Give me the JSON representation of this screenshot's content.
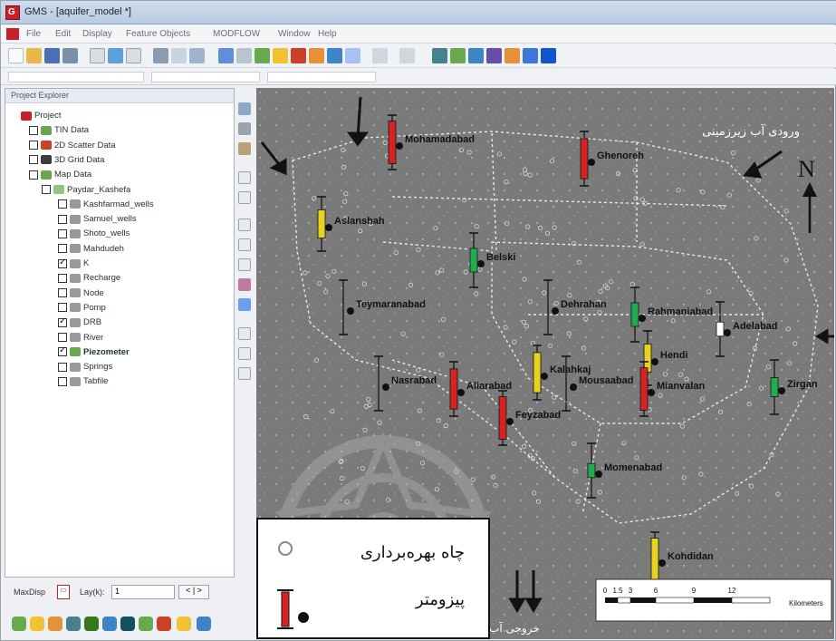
{
  "window": {
    "title": "GMS - [aquifer_model *]",
    "menu": [
      "File",
      "Edit",
      "Display",
      "Feature Objects",
      "MODFLOW",
      "Window",
      "Help"
    ]
  },
  "explorer": {
    "title": "Project Explorer",
    "tree": [
      {
        "label": "Project",
        "level": 0,
        "check": "none",
        "icon": "project-icon",
        "color": "#c8202a"
      },
      {
        "label": "TIN Data",
        "level": 1,
        "check": "empty",
        "icon": "tin-data-icon",
        "color": "#6aa84f"
      },
      {
        "label": "2D Scatter Data",
        "level": 1,
        "check": "empty",
        "icon": "scatter-data-icon",
        "color": "#cc4125"
      },
      {
        "label": "3D Grid Data",
        "level": 1,
        "check": "empty",
        "icon": "grid-data-icon",
        "color": "#3c3c3c"
      },
      {
        "label": "Map Data",
        "level": 1,
        "check": "empty",
        "icon": "map-data-icon",
        "color": "#6aa84f"
      },
      {
        "label": "Paydar_Kashefa",
        "level": 2,
        "check": "empty",
        "icon": "coverage-icon",
        "color": "#93c47d"
      },
      {
        "label": "Kashfarmad_wells",
        "level": 3,
        "check": "empty",
        "icon": "layer-icon",
        "color": "#999999"
      },
      {
        "label": "Samuel_wells",
        "level": 3,
        "check": "empty",
        "icon": "layer-icon",
        "color": "#999999"
      },
      {
        "label": "Shoto_wells",
        "level": 3,
        "check": "empty",
        "icon": "layer-icon",
        "color": "#999999"
      },
      {
        "label": "Mahdudeh",
        "level": 3,
        "check": "empty",
        "icon": "layer-icon",
        "color": "#999999"
      },
      {
        "label": "K",
        "level": 3,
        "check": "checked",
        "icon": "layer-icon",
        "color": "#999999"
      },
      {
        "label": "Recharge",
        "level": 3,
        "check": "empty",
        "icon": "layer-icon",
        "color": "#999999"
      },
      {
        "label": "Node",
        "level": 3,
        "check": "empty",
        "icon": "layer-icon",
        "color": "#999999"
      },
      {
        "label": "Pomp",
        "level": 3,
        "check": "empty",
        "icon": "layer-icon",
        "color": "#999999"
      },
      {
        "label": "DRB",
        "level": 3,
        "check": "checked",
        "icon": "layer-icon",
        "color": "#999999"
      },
      {
        "label": "River",
        "level": 3,
        "check": "empty",
        "icon": "layer-icon",
        "color": "#999999"
      },
      {
        "label": "Piezometer",
        "level": 3,
        "check": "checked",
        "icon": "layer-icon",
        "color": "#6aa84f",
        "bold": true
      },
      {
        "label": "Springs",
        "level": 3,
        "check": "empty",
        "icon": "layer-icon",
        "color": "#999999"
      },
      {
        "label": "Tabfile",
        "level": 3,
        "check": "empty",
        "icon": "layer-icon",
        "color": "#999999"
      }
    ]
  },
  "status": {
    "max_disp_label": "MaxDisp",
    "layer_label": "Lay(k):",
    "layer_value": "1",
    "arrows": "< | >"
  },
  "map": {
    "flow_in_label": "ورودی آب زیرزمینی",
    "flow_out_label": "خروجی آب زیرزمینی",
    "north_letter": "N",
    "legend": {
      "well_label": "چاه بهره‌برداری",
      "piezo_label": "پیزومتر"
    },
    "scalebar": {
      "ticks": [
        "0",
        "1.5",
        "3",
        "6",
        "9",
        "12"
      ],
      "unit": "Kilometers"
    },
    "sites": [
      {
        "name": "Mohamadabad",
        "color": "#d42323",
        "level": 0.9
      },
      {
        "name": "Ghenoreh",
        "color": "#d42323",
        "level": 0.85
      },
      {
        "name": "Aslanshah",
        "color": "#e6d21f",
        "level": 0.6
      },
      {
        "name": "Belski",
        "color": "#1fae4e",
        "level": 0.5
      },
      {
        "name": "Teymaranabad",
        "color": "#888888",
        "level": 0.0
      },
      {
        "name": "Dehrahan",
        "color": "#888888",
        "level": 0.0
      },
      {
        "name": "Rahmaniabad",
        "color": "#1fae4e",
        "level": 0.5
      },
      {
        "name": "Adelabad",
        "color": "#ffffff",
        "level": 0.3
      },
      {
        "name": "Hendi",
        "color": "#e6d21f",
        "level": 0.6
      },
      {
        "name": "Kalahkaj",
        "color": "#e6d21f",
        "level": 0.85
      },
      {
        "name": "Nasrabad",
        "color": "#888888",
        "level": 0.0
      },
      {
        "name": "Aliarabad",
        "color": "#d42323",
        "level": 0.85
      },
      {
        "name": "Mousaabad",
        "color": "#888888",
        "level": 0.0
      },
      {
        "name": "Mianvalan",
        "color": "#d42323",
        "level": 0.9
      },
      {
        "name": "Zirgan",
        "color": "#1fae4e",
        "level": 0.4
      },
      {
        "name": "Feyzabad",
        "color": "#d42323",
        "level": 0.9
      },
      {
        "name": "Momenabad",
        "color": "#1fae4e",
        "level": 0.3
      },
      {
        "name": "Kohdidan",
        "color": "#e6d21f",
        "level": 0.9
      }
    ]
  }
}
